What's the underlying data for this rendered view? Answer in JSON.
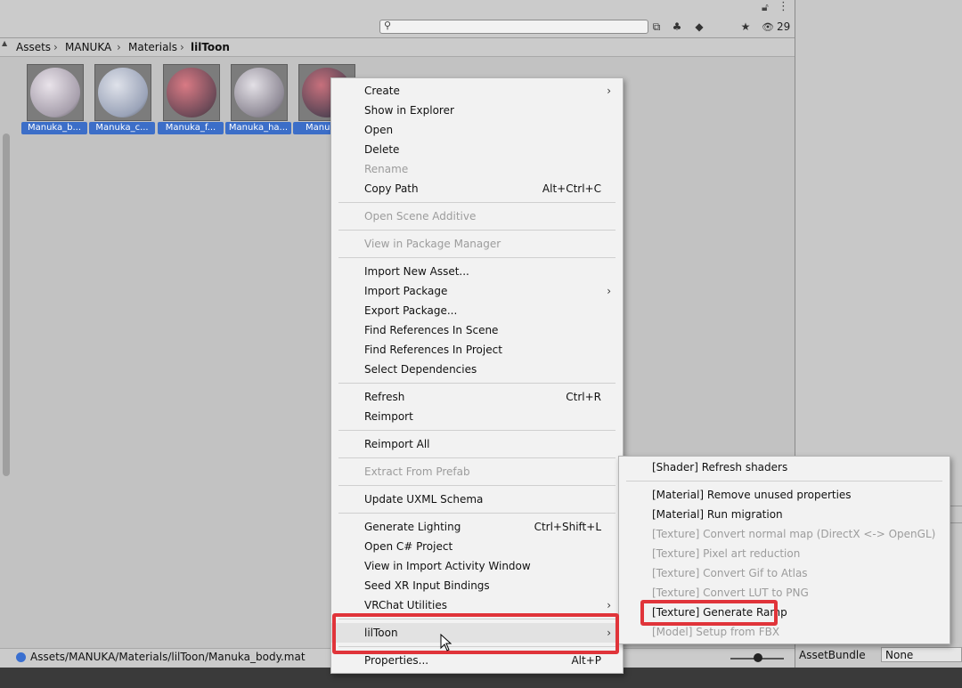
{
  "toolbar": {
    "search_placeholder": "",
    "hidden_count": "29"
  },
  "breadcrumb": [
    "Assets",
    "MANUKA",
    "Materials",
    "lilToon"
  ],
  "assets": [
    {
      "label": "Manuka_b...",
      "palette": [
        "#e9e3ea",
        "#a79fac"
      ]
    },
    {
      "label": "Manuka_c...",
      "palette": [
        "#dfe2ea",
        "#9aa3b8"
      ]
    },
    {
      "label": "Manuka_f...",
      "palette": [
        "#d97a84",
        "#6e4a58"
      ]
    },
    {
      "label": "Manuka_ha...",
      "palette": [
        "#e3e0e6",
        "#8f8a96"
      ]
    },
    {
      "label": "Manu",
      "palette": [
        "#c7707c",
        "#5a4656"
      ]
    }
  ],
  "status": {
    "path": "Assets/MANUKA/Materials/lilToon/Manuka_body.mat"
  },
  "inspector": {
    "asset_bundle_label": "AssetBundle",
    "asset_bundle_value": "None"
  },
  "context_menu": {
    "items": [
      {
        "label": "Create",
        "arrow": true
      },
      {
        "label": "Show in Explorer"
      },
      {
        "label": "Open"
      },
      {
        "label": "Delete"
      },
      {
        "label": "Rename",
        "disabled": true
      },
      {
        "label": "Copy Path",
        "shortcut": "Alt+Ctrl+C"
      },
      {
        "label": "Open Scene Additive",
        "disabled": true
      },
      {
        "label": "View in Package Manager",
        "disabled": true
      },
      {
        "label": "Import New Asset..."
      },
      {
        "label": "Import Package",
        "arrow": true
      },
      {
        "label": "Export Package..."
      },
      {
        "label": "Find References In Scene"
      },
      {
        "label": "Find References In Project"
      },
      {
        "label": "Select Dependencies"
      },
      {
        "label": "Refresh",
        "shortcut": "Ctrl+R"
      },
      {
        "label": "Reimport"
      },
      {
        "label": "Reimport All"
      },
      {
        "label": "Extract From Prefab",
        "disabled": true
      },
      {
        "label": "Update UXML Schema"
      },
      {
        "label": "Generate Lighting",
        "shortcut": "Ctrl+Shift+L"
      },
      {
        "label": "Open C# Project"
      },
      {
        "label": "View in Import Activity Window"
      },
      {
        "label": "Seed XR Input Bindings"
      },
      {
        "label": "VRChat Utilities",
        "arrow": true
      },
      {
        "label": "lilToon",
        "arrow": true
      },
      {
        "label": "Properties...",
        "shortcut": "Alt+P"
      }
    ]
  },
  "submenu": {
    "items": [
      {
        "label": "[Shader] Refresh shaders"
      },
      {
        "label": "[Material] Remove unused properties"
      },
      {
        "label": "[Material] Run migration"
      },
      {
        "label": "[Texture] Convert normal map (DirectX <-> OpenGL)",
        "disabled": true
      },
      {
        "label": "[Texture] Pixel art reduction",
        "disabled": true
      },
      {
        "label": "[Texture] Convert Gif to Atlas",
        "disabled": true
      },
      {
        "label": "[Texture] Convert LUT to PNG",
        "disabled": true
      },
      {
        "label": "[Texture] Generate Ramp"
      },
      {
        "label": "[Model] Setup from FBX",
        "disabled": true
      }
    ]
  }
}
